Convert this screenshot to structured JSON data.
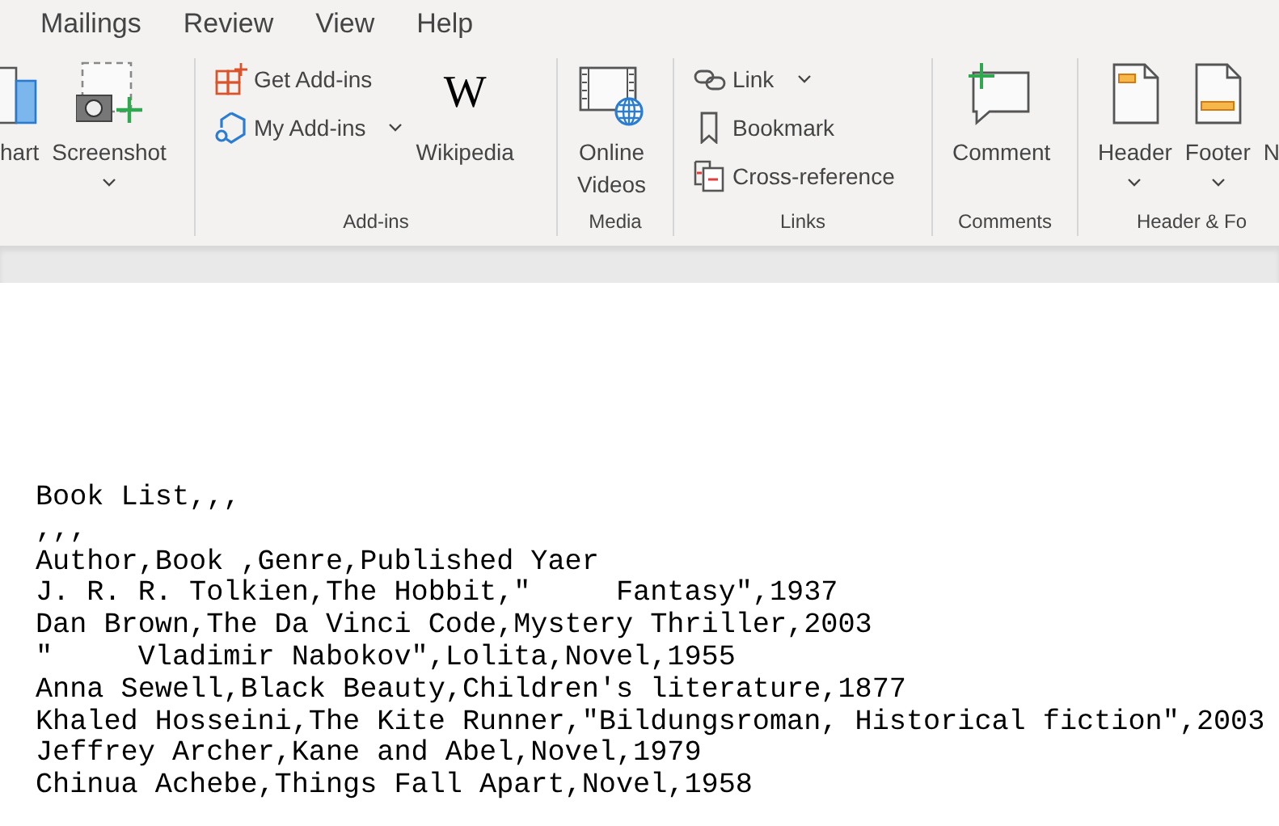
{
  "tabs": [
    {
      "label": "Mailings"
    },
    {
      "label": "Review"
    },
    {
      "label": "View"
    },
    {
      "label": "Help"
    }
  ],
  "groups": [
    {
      "items": [
        {
          "kind": "large",
          "label": "hart",
          "caret": false
        },
        {
          "kind": "large",
          "label": "Screenshot",
          "caret": true
        }
      ]
    },
    {
      "label": "Add-ins",
      "items": [
        {
          "kind": "small",
          "label": "Get Add-ins",
          "caret": false
        },
        {
          "kind": "small",
          "label": "My Add-ins",
          "caret": true
        },
        {
          "kind": "large",
          "label": "Wikipedia",
          "logo": "W",
          "caret": false
        }
      ]
    },
    {
      "label": "Media",
      "items": [
        {
          "kind": "large",
          "label": "Online\nVideos",
          "caret": false
        }
      ]
    },
    {
      "label": "Links",
      "items": [
        {
          "kind": "small",
          "label": "Link",
          "caret": true
        },
        {
          "kind": "small",
          "label": "Bookmark",
          "caret": false
        },
        {
          "kind": "small",
          "label": "Cross-reference",
          "caret": false
        }
      ]
    },
    {
      "label": "Comments",
      "items": [
        {
          "kind": "large",
          "label": "Comment",
          "caret": false
        }
      ]
    },
    {
      "label": "Header & Fo",
      "items": [
        {
          "kind": "large",
          "label": "Header",
          "caret": true
        },
        {
          "kind": "large",
          "label": "Footer",
          "caret": true
        },
        {
          "kind": "large",
          "label": "N",
          "caret": false
        }
      ]
    }
  ],
  "document": {
    "lines": [
      "Book List,,,",
      ",,,",
      "Author,Book ,Genre,Published Yaer",
      "J. R. R. Tolkien,The Hobbit,\"     Fantasy\",1937",
      "Dan Brown,The Da Vinci Code,Mystery Thriller,2003",
      "\"     Vladimir Nabokov\",Lolita,Novel,1955",
      "Anna Sewell,Black Beauty,Children's literature,1877",
      "Khaled Hosseini,The Kite Runner,\"Bildungsroman, Historical fiction\",2003",
      "Jeffrey Archer,Kane and Abel,Novel,1979",
      "Chinua Achebe,Things Fall Apart,Novel,1958"
    ]
  }
}
